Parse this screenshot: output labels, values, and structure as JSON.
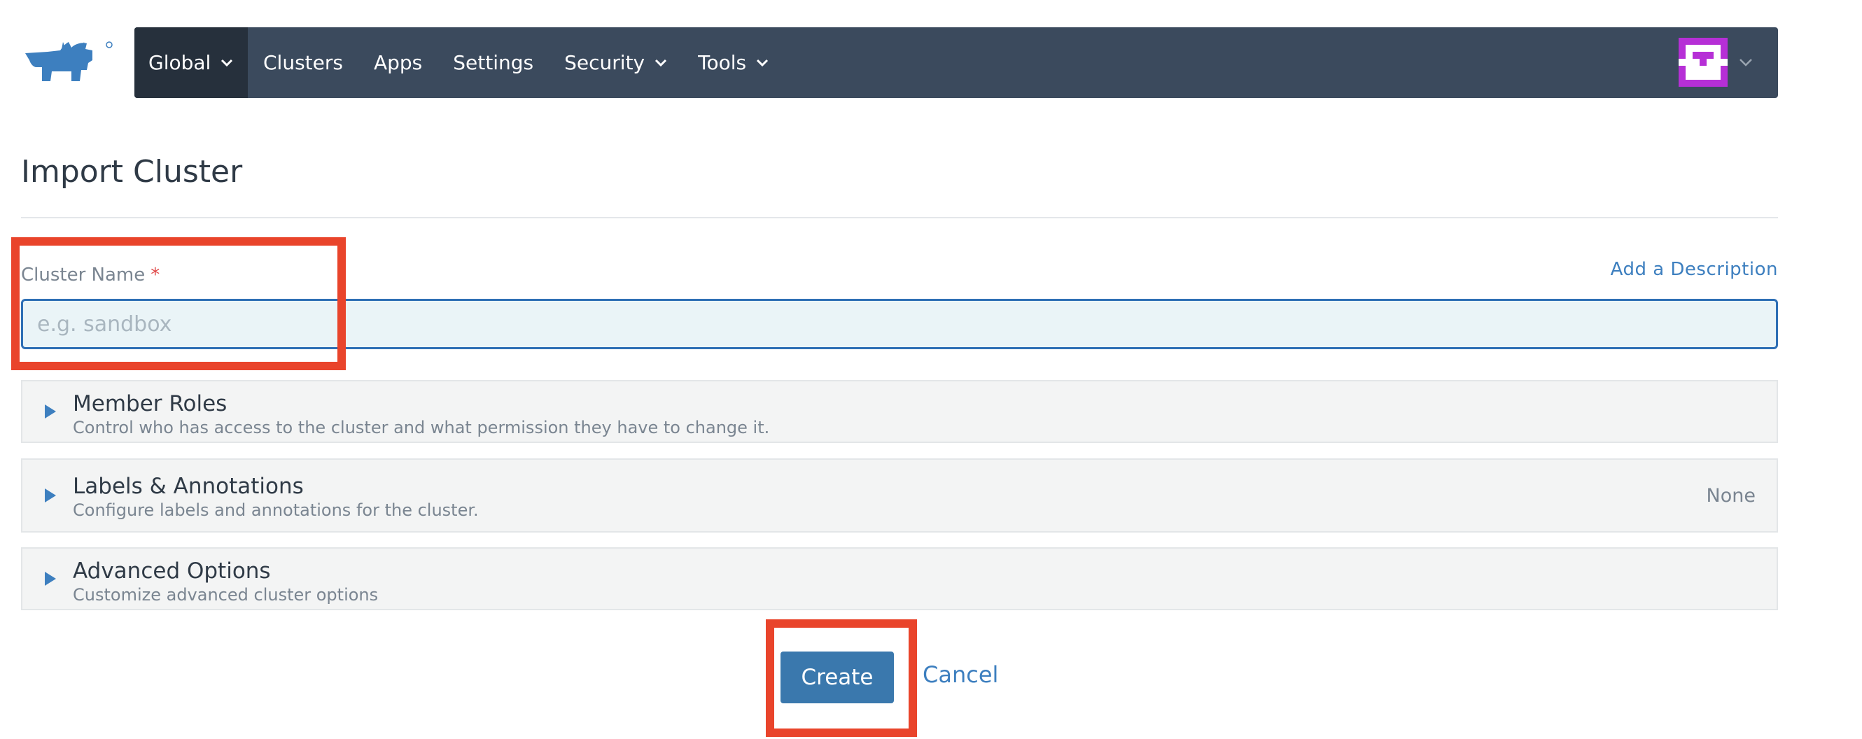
{
  "header": {
    "nav": [
      {
        "label": "Global",
        "dropdown": true,
        "active": true
      },
      {
        "label": "Clusters",
        "dropdown": false
      },
      {
        "label": "Apps",
        "dropdown": false
      },
      {
        "label": "Settings",
        "dropdown": false
      },
      {
        "label": "Security",
        "dropdown": true
      },
      {
        "label": "Tools",
        "dropdown": true
      }
    ],
    "logo_icon": "rancher-cow-logo",
    "avatar_icon": "identicon-avatar"
  },
  "page": {
    "title": "Import Cluster",
    "cluster_name": {
      "label": "Cluster Name",
      "required_mark": "*",
      "value": "",
      "placeholder": "e.g. sandbox"
    },
    "add_description": "Add a Description",
    "sections": [
      {
        "title": "Member Roles",
        "description": "Control who has access to the cluster and what permission they have to change it.",
        "status": ""
      },
      {
        "title": "Labels & Annotations",
        "description": "Configure labels and annotations for the cluster.",
        "status": "None"
      },
      {
        "title": "Advanced Options",
        "description": "Customize advanced cluster options",
        "status": ""
      }
    ],
    "actions": {
      "create": "Create",
      "cancel": "Cancel"
    }
  },
  "colors": {
    "nav_bg": "#3b4a5d",
    "nav_active_bg": "#26303c",
    "accent": "#3a78ad",
    "link": "#3d7fbf",
    "highlight": "#e9442b"
  }
}
